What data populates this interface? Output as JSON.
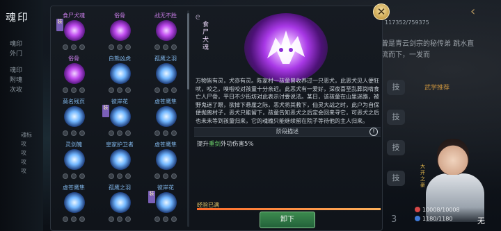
{
  "background": {
    "rail_title": "魂印",
    "rail_lines": [
      "魂印",
      "外门",
      "魂印",
      "附魂",
      "次攻"
    ],
    "rail_bullets": [
      "魂标",
      "攻",
      "攻",
      "攻",
      "攻"
    ],
    "counter": "117352/759375",
    "story_text": "曾是青云剑宗的秘传弟 跳水直流而下，一发而",
    "recommend": "武学推荐",
    "side_btn_labels": [
      "技",
      "技",
      "技",
      "技"
    ],
    "page_number": "3",
    "arrow": "‹"
  },
  "close_icon": "✕",
  "grid": {
    "items": [
      {
        "name": "食尸犬魂",
        "tier": "purple",
        "equipped": true,
        "equipped_label": "装"
      },
      {
        "name": "俗骨",
        "tier": "purple",
        "equipped": false
      },
      {
        "name": "战无不胜",
        "tier": "purple",
        "equipped": false
      },
      {
        "name": "俗骨",
        "tier": "purple",
        "equipped": false
      },
      {
        "name": "白熊凶虎",
        "tier": "blue",
        "equipped": false
      },
      {
        "name": "孤鹰之羽",
        "tier": "blue",
        "equipped": false
      },
      {
        "name": "莫名残页",
        "tier": "blue",
        "equipped": false
      },
      {
        "name": "彼岸花",
        "tier": "blue",
        "equipped": true,
        "equipped_label": "装"
      },
      {
        "name": "虚苍鹰隼",
        "tier": "blue",
        "equipped": false
      },
      {
        "name": "灵剑魄",
        "tier": "blue",
        "equipped": false
      },
      {
        "name": "皇家护卫者",
        "tier": "blue",
        "equipped": false
      },
      {
        "name": "虚苍鹰隼",
        "tier": "blue",
        "equipped": false
      },
      {
        "name": "虚苍鹰隼",
        "tier": "blue",
        "equipped": false
      },
      {
        "name": "孤鹰之羽",
        "tier": "blue",
        "equipped": false
      },
      {
        "name": "彼岸花",
        "tier": "blue",
        "equipped": true,
        "equipped_label": "装"
      }
    ]
  },
  "detail": {
    "swirl_icon": "ᘓ",
    "name": "食尸犬魂",
    "description": "万物皆有灵，犬亦有灵。陈家村一孩童曾收养过一只恶犬，此恶犬见人便狂吠，咬之，嗅啦咬对孩童十分亲近。此恶犬有一爱好，深夜喜至乱葬岗啃食亡人尸骨，平日不少街坊对此表示讨要说法。某日，该孩童在山里迷路，被野鬼迷了眼，欲掉下悬崖之际，恶犬将其救下，仙灵大战之时，此户为自保便抛离村子，恶犬只能留下，孩童告知恶犬之后定会回来寻它，可恶犬之后也未未等到孩童归来，它的魂魄只能继续留在院子等待他的主人归来。",
    "stage_label": "阶段描述",
    "warn_icon": "!",
    "stat_prefix": "提升",
    "stat_highlight": "重剑",
    "stat_suffix": "外功伤害5%",
    "exp_label": "经验已满",
    "exp_fraction": 1.0,
    "unload_label": "卸下"
  },
  "character": {
    "tag": "大开之豪",
    "name": "无",
    "hp": "10008/10008",
    "mp": "1180/1180"
  }
}
